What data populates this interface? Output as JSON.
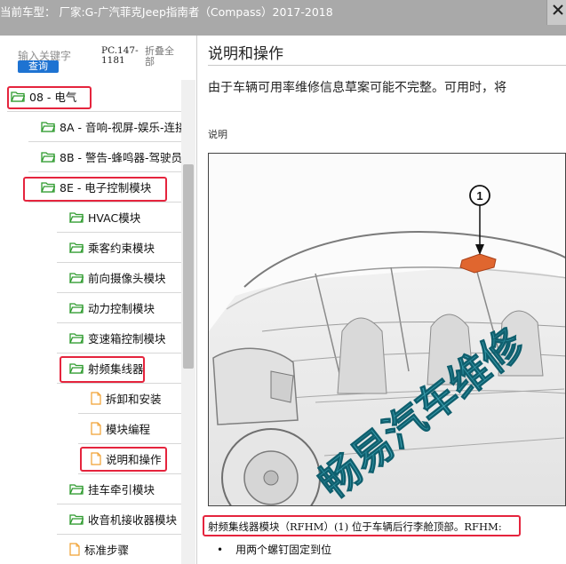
{
  "window": {
    "title": "当前车型： 厂家:G-广汽菲克Jeep指南者（Compass）2017-2018"
  },
  "search": {
    "keyword_placeholder": "输入关键字",
    "query_label": "查询",
    "pc_code": "PC.147-1181",
    "collapse_label": "折叠全部"
  },
  "tree": {
    "items": [
      {
        "label": "08 - 电气",
        "icon": "folder-open-icon",
        "highlighted": true
      },
      {
        "label": "8A - 音响-视屏-娱乐-连接",
        "icon": "folder-open-icon",
        "highlighted": false
      },
      {
        "label": "8B - 警告-蜂鸣器-驾驶员",
        "icon": "folder-open-icon",
        "highlighted": false
      },
      {
        "label": "8E - 电子控制模块",
        "icon": "folder-open-icon",
        "highlighted": true
      },
      {
        "label": "HVAC模块",
        "icon": "folder-open-icon",
        "highlighted": false
      },
      {
        "label": "乘客约束模块",
        "icon": "folder-open-icon",
        "highlighted": false
      },
      {
        "label": "前向摄像头模块",
        "icon": "folder-open-icon",
        "highlighted": false
      },
      {
        "label": "动力控制模块",
        "icon": "folder-open-icon",
        "highlighted": false
      },
      {
        "label": "变速箱控制模块",
        "icon": "folder-open-icon",
        "highlighted": false
      },
      {
        "label": "射频集线器",
        "icon": "folder-open-icon",
        "highlighted": true
      },
      {
        "label": "拆卸和安装",
        "icon": "document-icon",
        "highlighted": false
      },
      {
        "label": "模块编程",
        "icon": "document-icon",
        "highlighted": false
      },
      {
        "label": "说明和操作",
        "icon": "document-icon",
        "highlighted": true
      },
      {
        "label": "挂车牵引模块",
        "icon": "folder-open-icon",
        "highlighted": false
      },
      {
        "label": "收音机接收器模块",
        "icon": "folder-open-icon",
        "highlighted": false
      },
      {
        "label": "标准步骤",
        "icon": "document-icon",
        "highlighted": false
      }
    ]
  },
  "content": {
    "title": "说明和操作",
    "intro": "由于车辆可用率维修信息草案可能不完整。可用时，将",
    "section_label": "说明",
    "figure": {
      "callout_number": "1",
      "watermark": "畅易汽车维修"
    },
    "caption": "射频集线器模块（RFHM）(1) 位于车辆后行李舱顶部。RFHM:",
    "bullets": [
      "用两个螺钉固定到位"
    ]
  },
  "colors": {
    "titlebar_bg": "#a9a9a9",
    "query_button": "#1e73d2",
    "highlight_border": "#e5243d",
    "folder_green": "#2f9b2f",
    "document_orange": "#f0a030",
    "component_orange": "#e0662f",
    "watermark_teal": "#1a8fa3"
  }
}
